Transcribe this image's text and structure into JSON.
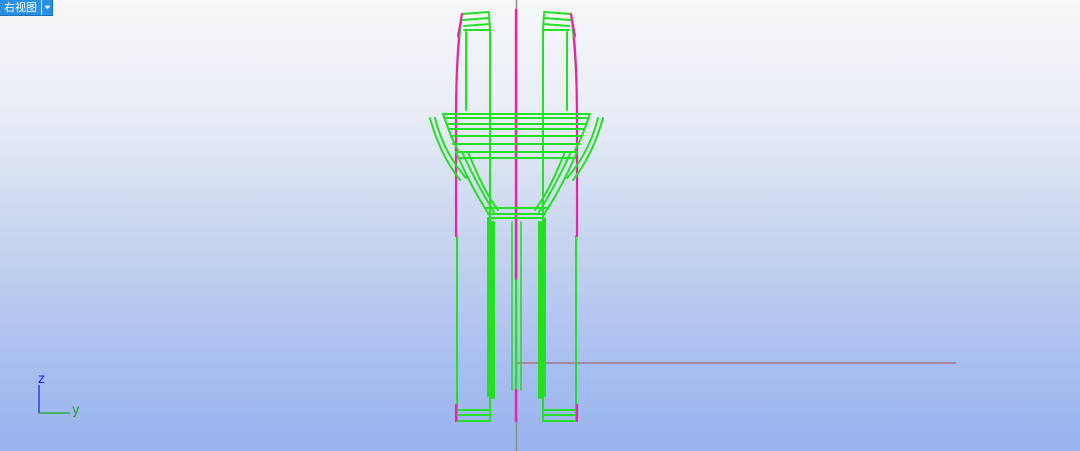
{
  "viewport": {
    "view_name": "右视图",
    "dropdown_icon": "chevron-down-icon"
  },
  "axis_indicator": {
    "z_label": "z",
    "y_label": "y",
    "z_color": "#1a1ae6",
    "y_color": "#1aa81a"
  },
  "colors": {
    "background_top": "#f7f7f9",
    "background_bottom": "#98b4ee",
    "wireframe_green": "#22e022",
    "wireframe_magenta": "#ee22aa",
    "world_axis_red": "#a05050",
    "world_axis_gray": "#8a8a8a",
    "tab_blue": "#2a8fe0"
  }
}
